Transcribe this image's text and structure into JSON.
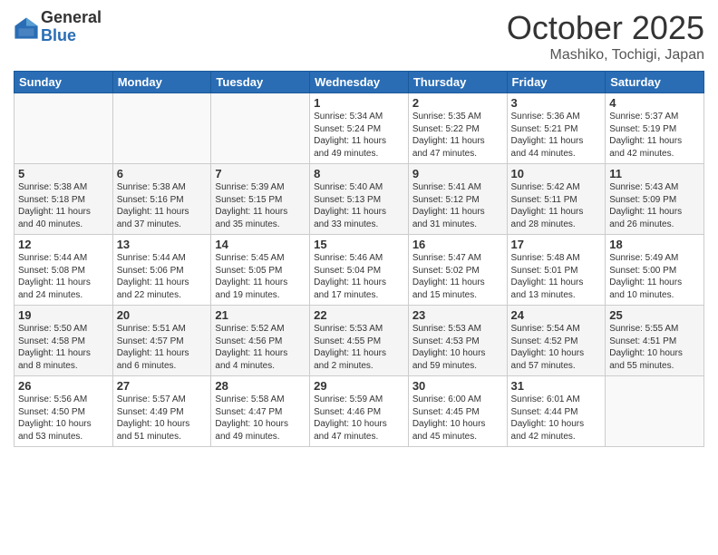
{
  "header": {
    "logo_general": "General",
    "logo_blue": "Blue",
    "month_title": "October 2025",
    "location": "Mashiko, Tochigi, Japan"
  },
  "days_of_week": [
    "Sunday",
    "Monday",
    "Tuesday",
    "Wednesday",
    "Thursday",
    "Friday",
    "Saturday"
  ],
  "weeks": [
    [
      {
        "day": "",
        "content": ""
      },
      {
        "day": "",
        "content": ""
      },
      {
        "day": "",
        "content": ""
      },
      {
        "day": "1",
        "content": "Sunrise: 5:34 AM\nSunset: 5:24 PM\nDaylight: 11 hours\nand 49 minutes."
      },
      {
        "day": "2",
        "content": "Sunrise: 5:35 AM\nSunset: 5:22 PM\nDaylight: 11 hours\nand 47 minutes."
      },
      {
        "day": "3",
        "content": "Sunrise: 5:36 AM\nSunset: 5:21 PM\nDaylight: 11 hours\nand 44 minutes."
      },
      {
        "day": "4",
        "content": "Sunrise: 5:37 AM\nSunset: 5:19 PM\nDaylight: 11 hours\nand 42 minutes."
      }
    ],
    [
      {
        "day": "5",
        "content": "Sunrise: 5:38 AM\nSunset: 5:18 PM\nDaylight: 11 hours\nand 40 minutes."
      },
      {
        "day": "6",
        "content": "Sunrise: 5:38 AM\nSunset: 5:16 PM\nDaylight: 11 hours\nand 37 minutes."
      },
      {
        "day": "7",
        "content": "Sunrise: 5:39 AM\nSunset: 5:15 PM\nDaylight: 11 hours\nand 35 minutes."
      },
      {
        "day": "8",
        "content": "Sunrise: 5:40 AM\nSunset: 5:13 PM\nDaylight: 11 hours\nand 33 minutes."
      },
      {
        "day": "9",
        "content": "Sunrise: 5:41 AM\nSunset: 5:12 PM\nDaylight: 11 hours\nand 31 minutes."
      },
      {
        "day": "10",
        "content": "Sunrise: 5:42 AM\nSunset: 5:11 PM\nDaylight: 11 hours\nand 28 minutes."
      },
      {
        "day": "11",
        "content": "Sunrise: 5:43 AM\nSunset: 5:09 PM\nDaylight: 11 hours\nand 26 minutes."
      }
    ],
    [
      {
        "day": "12",
        "content": "Sunrise: 5:44 AM\nSunset: 5:08 PM\nDaylight: 11 hours\nand 24 minutes."
      },
      {
        "day": "13",
        "content": "Sunrise: 5:44 AM\nSunset: 5:06 PM\nDaylight: 11 hours\nand 22 minutes."
      },
      {
        "day": "14",
        "content": "Sunrise: 5:45 AM\nSunset: 5:05 PM\nDaylight: 11 hours\nand 19 minutes."
      },
      {
        "day": "15",
        "content": "Sunrise: 5:46 AM\nSunset: 5:04 PM\nDaylight: 11 hours\nand 17 minutes."
      },
      {
        "day": "16",
        "content": "Sunrise: 5:47 AM\nSunset: 5:02 PM\nDaylight: 11 hours\nand 15 minutes."
      },
      {
        "day": "17",
        "content": "Sunrise: 5:48 AM\nSunset: 5:01 PM\nDaylight: 11 hours\nand 13 minutes."
      },
      {
        "day": "18",
        "content": "Sunrise: 5:49 AM\nSunset: 5:00 PM\nDaylight: 11 hours\nand 10 minutes."
      }
    ],
    [
      {
        "day": "19",
        "content": "Sunrise: 5:50 AM\nSunset: 4:58 PM\nDaylight: 11 hours\nand 8 minutes."
      },
      {
        "day": "20",
        "content": "Sunrise: 5:51 AM\nSunset: 4:57 PM\nDaylight: 11 hours\nand 6 minutes."
      },
      {
        "day": "21",
        "content": "Sunrise: 5:52 AM\nSunset: 4:56 PM\nDaylight: 11 hours\nand 4 minutes."
      },
      {
        "day": "22",
        "content": "Sunrise: 5:53 AM\nSunset: 4:55 PM\nDaylight: 11 hours\nand 2 minutes."
      },
      {
        "day": "23",
        "content": "Sunrise: 5:53 AM\nSunset: 4:53 PM\nDaylight: 10 hours\nand 59 minutes."
      },
      {
        "day": "24",
        "content": "Sunrise: 5:54 AM\nSunset: 4:52 PM\nDaylight: 10 hours\nand 57 minutes."
      },
      {
        "day": "25",
        "content": "Sunrise: 5:55 AM\nSunset: 4:51 PM\nDaylight: 10 hours\nand 55 minutes."
      }
    ],
    [
      {
        "day": "26",
        "content": "Sunrise: 5:56 AM\nSunset: 4:50 PM\nDaylight: 10 hours\nand 53 minutes."
      },
      {
        "day": "27",
        "content": "Sunrise: 5:57 AM\nSunset: 4:49 PM\nDaylight: 10 hours\nand 51 minutes."
      },
      {
        "day": "28",
        "content": "Sunrise: 5:58 AM\nSunset: 4:47 PM\nDaylight: 10 hours\nand 49 minutes."
      },
      {
        "day": "29",
        "content": "Sunrise: 5:59 AM\nSunset: 4:46 PM\nDaylight: 10 hours\nand 47 minutes."
      },
      {
        "day": "30",
        "content": "Sunrise: 6:00 AM\nSunset: 4:45 PM\nDaylight: 10 hours\nand 45 minutes."
      },
      {
        "day": "31",
        "content": "Sunrise: 6:01 AM\nSunset: 4:44 PM\nDaylight: 10 hours\nand 42 minutes."
      },
      {
        "day": "",
        "content": ""
      }
    ]
  ]
}
